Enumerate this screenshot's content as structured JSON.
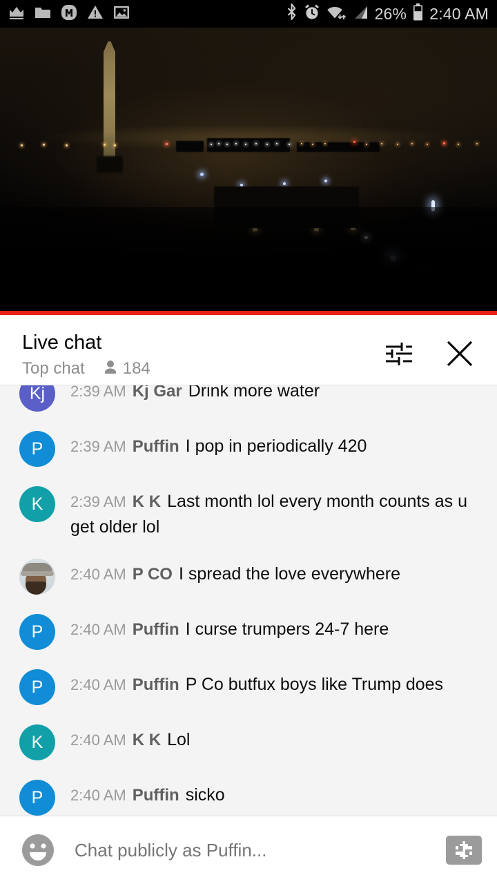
{
  "status_bar": {
    "icons_left": [
      "crown-icon",
      "folder-icon",
      "m-badge-icon",
      "warning-icon",
      "image-icon"
    ],
    "icons_right": [
      "bluetooth-icon",
      "alarm-icon",
      "wifi-icon",
      "signal-icon"
    ],
    "battery_percent": "26%",
    "battery_icon": "battery-icon",
    "time": "2:40 AM"
  },
  "video": {
    "name": "live-video-player",
    "description": "Washington Monument at night",
    "accent_color": "#e62117"
  },
  "chat_header": {
    "title": "Live chat",
    "mode": "Top chat",
    "viewer_icon": "person-icon",
    "viewer_count": "184",
    "settings_icon": "tune-icon",
    "close_icon": "close-icon"
  },
  "messages": [
    {
      "time": "2:39 AM",
      "author": "Kj Gar",
      "text": "Drink more water",
      "avatar_text": "Kj",
      "avatar_color": "#5a5fc7",
      "avatar_type": "initials"
    },
    {
      "time": "2:39 AM",
      "author": "Puffin",
      "text": "I pop in periodically 420",
      "avatar_text": "P",
      "avatar_color": "#118cd6",
      "avatar_type": "initials"
    },
    {
      "time": "2:39 AM",
      "author": "K K",
      "text": "Last month lol every month counts as u get older lol",
      "avatar_text": "K",
      "avatar_color": "#11a0a8",
      "avatar_type": "initials"
    },
    {
      "time": "2:40 AM",
      "author": "P CO",
      "text": "I spread the love everywhere",
      "avatar_text": "",
      "avatar_color": "#cfd4d6",
      "avatar_type": "photo"
    },
    {
      "time": "2:40 AM",
      "author": "Puffin",
      "text": "I curse trumpers 24-7 here",
      "avatar_text": "P",
      "avatar_color": "#118cd6",
      "avatar_type": "initials"
    },
    {
      "time": "2:40 AM",
      "author": "Puffin",
      "text": "P Co butfux boys like Trump does",
      "avatar_text": "P",
      "avatar_color": "#118cd6",
      "avatar_type": "initials"
    },
    {
      "time": "2:40 AM",
      "author": "K K",
      "text": "Lol",
      "avatar_text": "K",
      "avatar_color": "#11a0a8",
      "avatar_type": "initials"
    },
    {
      "time": "2:40 AM",
      "author": "Puffin",
      "text": "sicko",
      "avatar_text": "P",
      "avatar_color": "#118cd6",
      "avatar_type": "initials"
    }
  ],
  "input_bar": {
    "emoji_icon": "emoji-icon",
    "placeholder": "Chat publicly as Puffin...",
    "value": "",
    "superchat_icon": "dollar-icon"
  }
}
